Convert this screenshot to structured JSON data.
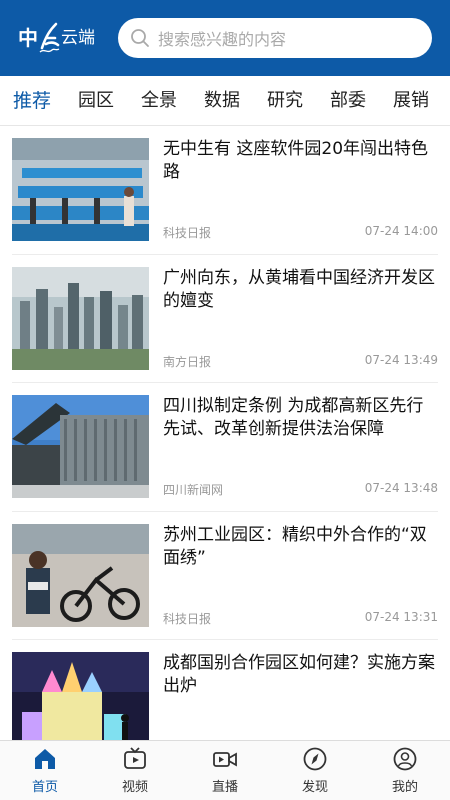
{
  "header": {
    "logo_prefix": "中",
    "logo_suffix": "云端",
    "search_placeholder": "搜索感兴趣的内容"
  },
  "tabs": [
    {
      "label": "推荐",
      "active": true
    },
    {
      "label": "园区"
    },
    {
      "label": "全景"
    },
    {
      "label": "数据"
    },
    {
      "label": "研究"
    },
    {
      "label": "部委"
    },
    {
      "label": "展销"
    }
  ],
  "news": [
    {
      "title": "无中生有 这座软件园20年闯出特色路",
      "source": "科技日报",
      "time": "07-24 14:00",
      "image": "factory-icon"
    },
    {
      "title": "广州向东，从黄埔看中国经济开发区的嬗变",
      "source": "南方日报",
      "time": "07-24 13:49",
      "image": "city-icon"
    },
    {
      "title": "四川拟制定条例 为成都高新区先行先试、改革创新提供法治保障",
      "source": "四川新闻网",
      "time": "07-24 13:48",
      "image": "building-icon"
    },
    {
      "title": "苏州工业园区：精织中外合作的“双面绣”",
      "source": "科技日报",
      "time": "07-24 13:31",
      "image": "workshop-icon"
    },
    {
      "title": "成都国别合作园区如何建？实施方案出炉",
      "source": "",
      "time": "",
      "image": "castle-icon"
    }
  ],
  "bottom_nav": [
    {
      "label": "首页",
      "icon": "home-icon",
      "active": true
    },
    {
      "label": "视频",
      "icon": "tv-icon"
    },
    {
      "label": "直播",
      "icon": "video-camera-icon"
    },
    {
      "label": "发现",
      "icon": "compass-icon"
    },
    {
      "label": "我的",
      "icon": "user-icon"
    }
  ],
  "colors": {
    "brand": "#0d5aa7",
    "muted": "#999999"
  }
}
